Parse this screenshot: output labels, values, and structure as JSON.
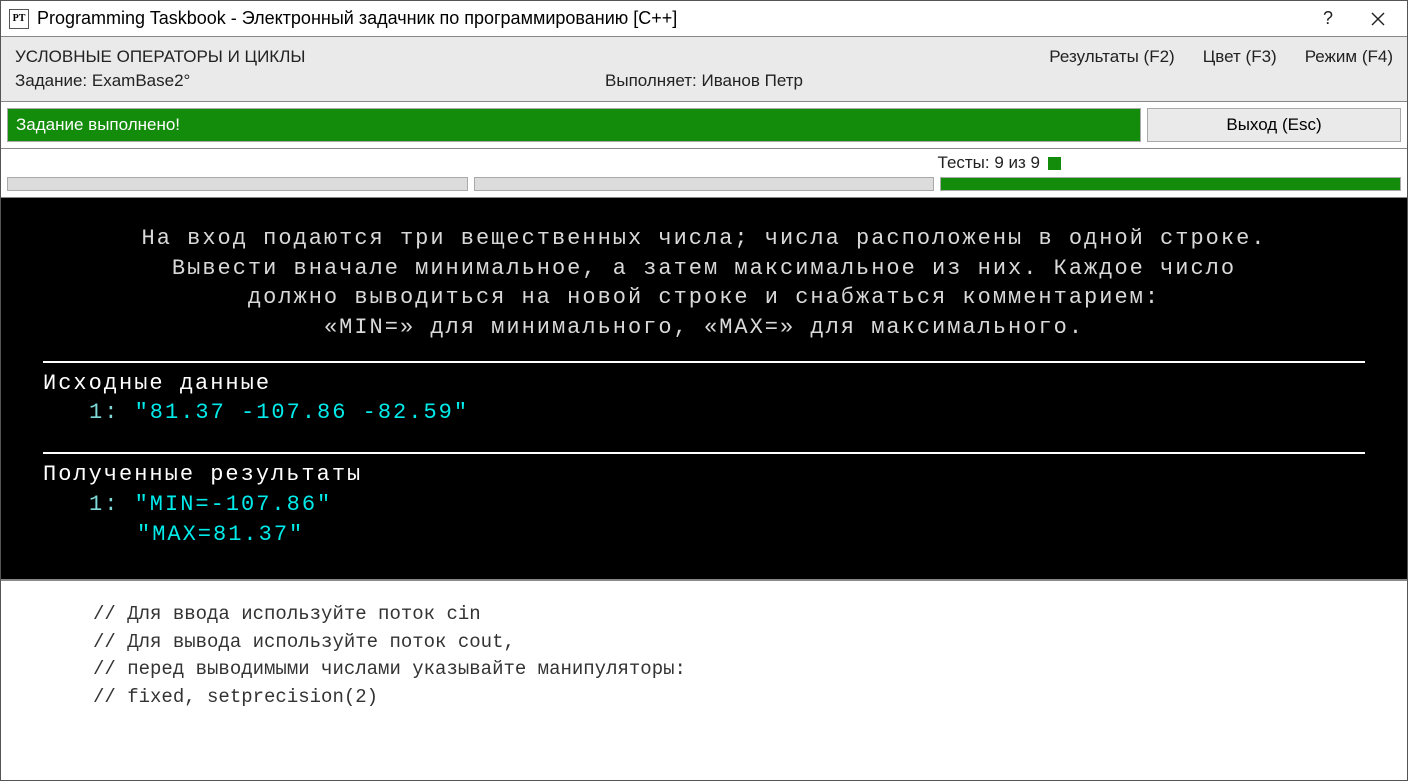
{
  "titlebar": {
    "icon_text": "PT",
    "title": "Programming Taskbook - Электронный задачник по программированию [C++]"
  },
  "header": {
    "topic": "УСЛОВНЫЕ ОПЕРАТОРЫ И ЦИКЛЫ",
    "task_label": "Задание: ExamBase2°",
    "performer_label": "Выполняет: Иванов Петр",
    "menu": {
      "results": "Результаты (F2)",
      "color": "Цвет (F3)",
      "mode": "Режим (F4)"
    }
  },
  "status": {
    "message": "Задание выполнено!",
    "exit_label": "Выход (Esc)"
  },
  "tests": {
    "label": "Тесты:  9 из 9"
  },
  "console": {
    "desc_l1": "На вход подаются три вещественных числа; числа расположены в одной строке.",
    "desc_l2": "Вывести вначале минимальное, а затем максимальное из них. Каждое число",
    "desc_l3": "должно выводиться на новой строке и снабжаться комментарием:",
    "desc_l4": "«MIN=» для минимального, «MAX=» для максимального.",
    "input_title": "Исходные данные",
    "input_num": "1:",
    "input_val": "\"81.37 -107.86 -82.59\"",
    "output_title": "Полученные результаты",
    "output_num": "1:",
    "output_val1": "\"MIN=-107.86\"",
    "output_val2": "\"MAX=81.37\""
  },
  "footer": {
    "l1": "// Для ввода используйте поток cin",
    "l2": "// Для вывода используйте поток cout,",
    "l3": "// перед выводимыми числами указывайте манипуляторы:",
    "l4": "// fixed, setprecision(2)"
  }
}
